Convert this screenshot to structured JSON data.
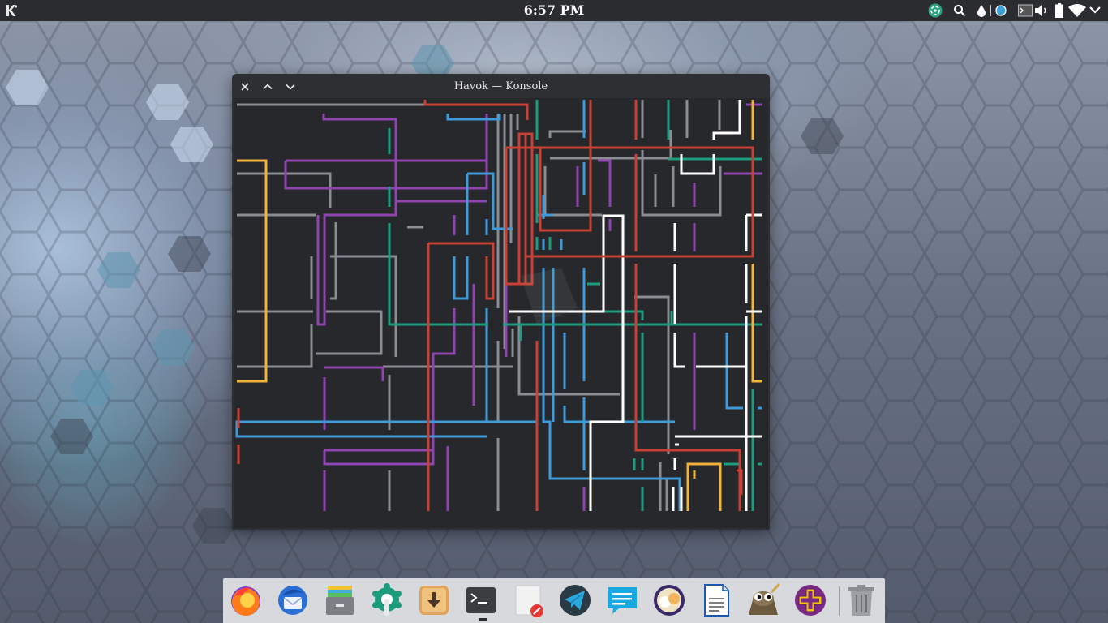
{
  "top_panel": {
    "clock": "6:57 PM",
    "launcher_icon": "kde-logo-icon",
    "tray_icons": [
      "system-update-icon",
      "search-icon",
      "droplet-icon",
      "circle-indicator-icon",
      "terminal-icon",
      "volume-icon",
      "battery-icon",
      "wifi-icon",
      "chevron-down-icon"
    ]
  },
  "window": {
    "title": "Havok — Konsole",
    "buttons": [
      "close-icon",
      "minimize-icon",
      "maximize-icon"
    ],
    "content": "pipes-screensaver-animation",
    "pipe_colors": [
      "#c94034",
      "#8f44b0",
      "#3f9ad9",
      "#1f9c7f",
      "#f2b33d",
      "#ffffff",
      "#8a8d91"
    ]
  },
  "dock": {
    "apps": [
      "firefox-icon",
      "thunderbird-icon",
      "file-archiver-icon",
      "settings-icon",
      "downloader-icon",
      "terminal-icon",
      "text-editor-icon",
      "telegram-icon",
      "chat-icon",
      "screenshot-icon",
      "document-icon",
      "gimp-icon",
      "add-icon",
      "trash-icon"
    ]
  }
}
